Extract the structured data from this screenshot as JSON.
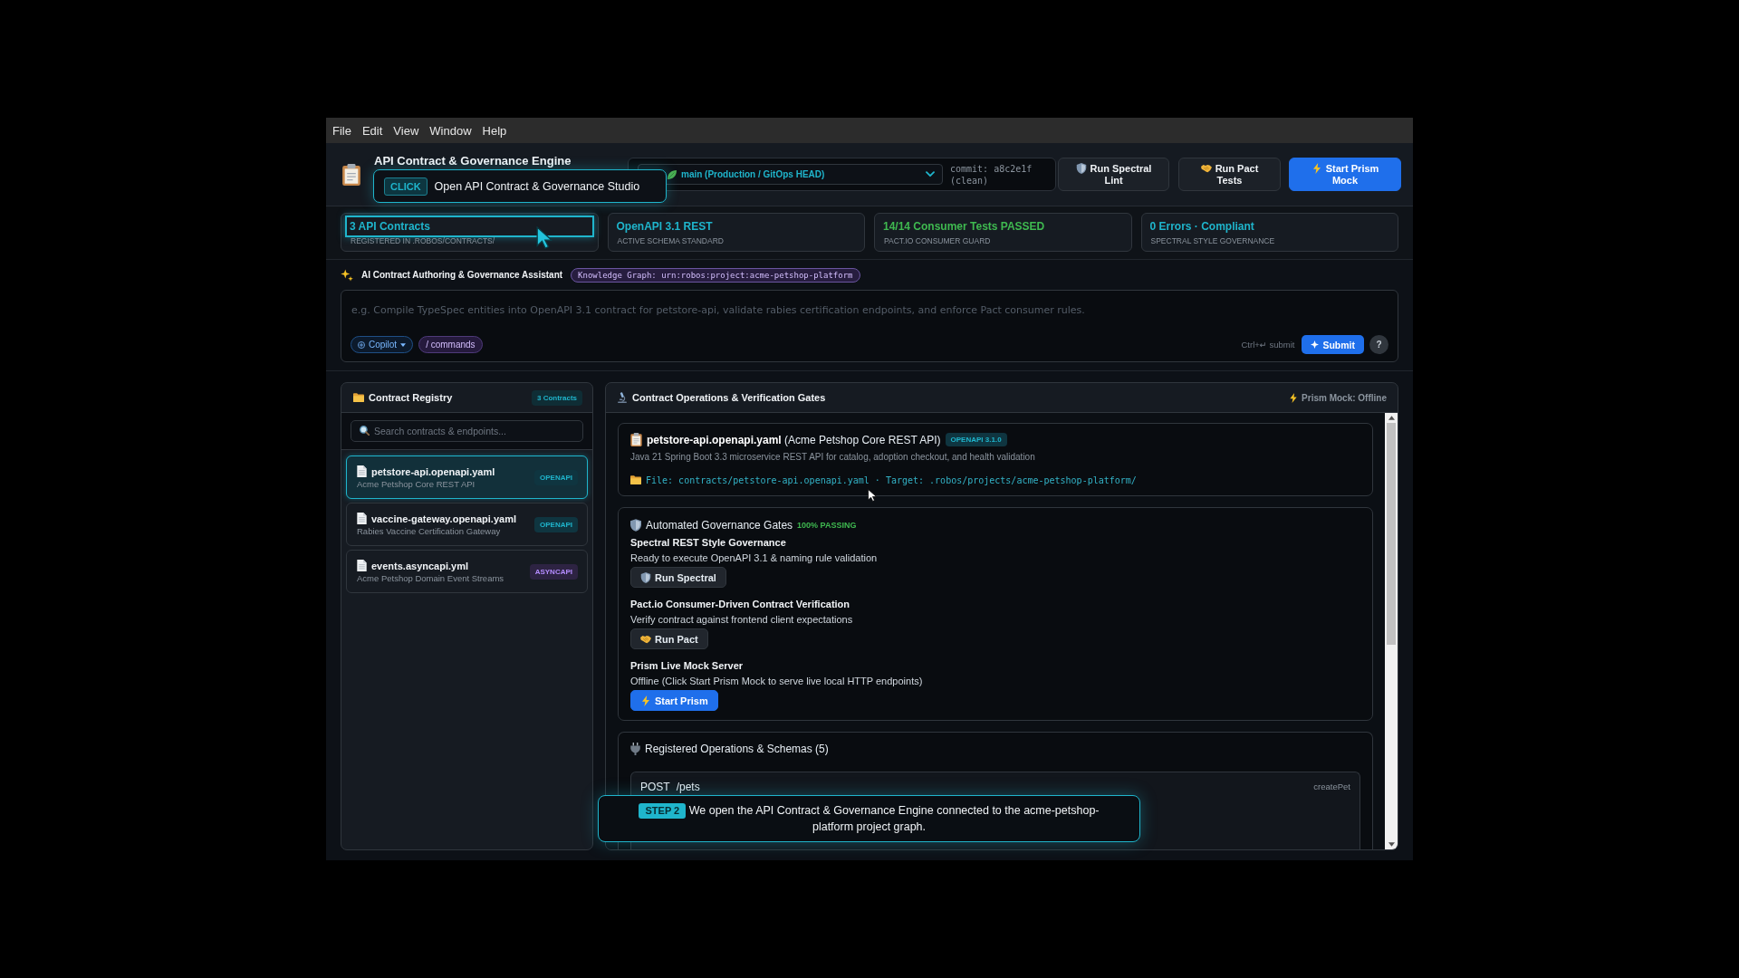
{
  "menu_bar": {
    "items": [
      "File",
      "Edit",
      "View",
      "Window",
      "Help"
    ]
  },
  "header": {
    "title": "API Contract & Governance Engine",
    "branch_select": {
      "value": "main (Production / GitOps HEAD)"
    },
    "commit": "commit: a8c2e1f (clean)",
    "actions": [
      {
        "label": "Run Spectral Lint",
        "kind": "secondary"
      },
      {
        "label": "Run Pact Tests",
        "kind": "secondary"
      },
      {
        "label": "Start Prism Mock",
        "kind": "primary"
      }
    ]
  },
  "stats": [
    {
      "value": "3 API Contracts",
      "caption": "REGISTERED IN .ROBOS/CONTRACTS/",
      "color": "#1fb5cc",
      "highlighted": true
    },
    {
      "value": "OpenAPI 3.1 REST",
      "caption": "ACTIVE SCHEMA STANDARD",
      "color": "#1fb5cc",
      "highlighted": false
    },
    {
      "value": "14/14 Consumer Tests PASSED",
      "caption": "PACT.IO CONSUMER GUARD",
      "color": "#3fb950",
      "highlighted": false
    },
    {
      "value": "0 Errors · Compliant",
      "caption": "SPECTRAL STYLE GOVERNANCE",
      "color": "#1fb5cc",
      "highlighted": false
    }
  ],
  "assistant": {
    "title": "AI Contract Authoring & Governance Assistant",
    "graph_badge": "Knowledge Graph: urn:robos:project:acme-petshop-platform",
    "prompt": {
      "placeholder": "e.g. Compile TypeSpec entities into OpenAPI 3.1 contract for petstore-api, validate rabies certification endpoints, and enforce Pact consumer rules."
    },
    "model_chip": "Copilot",
    "commands_chip": "/ commands",
    "shortcut_hint": "Ctrl+↵ submit",
    "submit_button": "Submit",
    "help_button": "?"
  },
  "registry": {
    "title": "Contract Registry",
    "count_badge": "3 Contracts",
    "search": {
      "placeholder": "Search contracts & endpoints..."
    },
    "contracts": [
      {
        "name": "petstore-api.openapi.yaml",
        "description": "Acme Petshop Core REST API",
        "tag": "OPENAPI",
        "kind": "openapi",
        "selected": true
      },
      {
        "name": "vaccine-gateway.openapi.yaml",
        "description": "Rabies Vaccine Certification Gateway",
        "tag": "OPENAPI",
        "kind": "openapi",
        "selected": false
      },
      {
        "name": "events.asyncapi.yml",
        "description": "Acme Petshop Domain Event Streams",
        "tag": "ASYNCAPI",
        "kind": "asyncapi",
        "selected": false
      }
    ]
  },
  "operations_panel": {
    "title": "Contract Operations & Verification Gates",
    "mock_status": "Prism Mock: Offline",
    "contract_card": {
      "title": "**petstore-api.openapi.yaml** (Acme Petshop Core REST API)",
      "version_badge": "OPENAPI 3.1.0",
      "description": "Java 21 Spring Boot 3.3 microservice REST API for catalog, adoption checkout, and health validation",
      "path": "File: contracts/petstore-api.openapi.yaml · Target: .robos/projects/acme-petshop-platform/"
    },
    "gates_card": {
      "title": "Automated Governance Gates",
      "status": "100% PASSING",
      "gates": [
        {
          "name": "Spectral REST Style Governance",
          "description": "Ready to execute OpenAPI 3.1 & naming rule validation",
          "button": "Run Spectral",
          "kind": "secondary"
        },
        {
          "name": "Pact.io Consumer-Driven Contract Verification",
          "description": "Verify contract against frontend client expectations",
          "button": "Run Pact",
          "kind": "secondary"
        },
        {
          "name": "Prism Live Mock Server",
          "description": "Offline (Click Start Prism Mock to serve live local HTTP endpoints)",
          "button": "Start Prism",
          "kind": "primary"
        }
      ]
    },
    "operations_card": {
      "title": "Registered Operations & Schemas (5)",
      "operations": [
        {
          "method": "POST",
          "path": "/pets",
          "operation_id": "createPet"
        }
      ]
    }
  },
  "tutorial": {
    "click_callout": {
      "badge": "CLICK",
      "text": "Open API Contract & Governance Studio"
    },
    "step_callout": {
      "badge": "STEP 2",
      "text": "We open the API Contract & Governance Engine connected to the acme-petshop-platform project graph."
    }
  }
}
